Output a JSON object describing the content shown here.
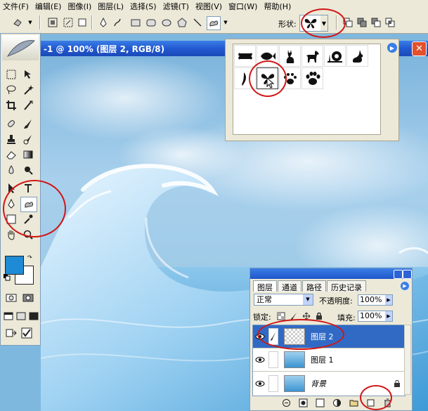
{
  "menubar": {
    "items": [
      "文件(F)",
      "编辑(E)",
      "图像(I)",
      "图层(L)",
      "选择(S)",
      "滤镜(T)",
      "视图(V)",
      "窗口(W)",
      "帮助(H)"
    ]
  },
  "options_bar": {
    "shape_label": "形状:"
  },
  "document": {
    "title": "-1 @ 100% (图层 2, RGB/8)",
    "close_label": "✕"
  },
  "shapes_popup": {
    "row1": [
      "bone-icon",
      "fish-icon",
      "cat-icon",
      "dog-icon",
      "snail-icon",
      "rabbit-icon"
    ],
    "row2": [
      "bird-icon",
      "butterfly-icon",
      "paw-print-icon",
      "paw-print-2-icon"
    ],
    "menu_glyph": "▶"
  },
  "layers_panel": {
    "tabs": [
      "图层",
      "通道",
      "路径",
      "历史记录"
    ],
    "blend_mode": "正常",
    "opacity_label": "不透明度:",
    "opacity_value": "100%",
    "lock_label": "锁定:",
    "fill_label": "填充:",
    "fill_value": "100%",
    "layers": [
      {
        "name": "图层 2",
        "selected": true,
        "thumb": "checker"
      },
      {
        "name": "图层 1",
        "selected": false,
        "thumb": "sea"
      },
      {
        "name": "背景",
        "selected": false,
        "thumb": "sea"
      }
    ]
  },
  "colors": {
    "foreground": "#1e8bd4",
    "background": "#ffffff",
    "annotation": "#d01616",
    "selection": "#316ac5"
  }
}
